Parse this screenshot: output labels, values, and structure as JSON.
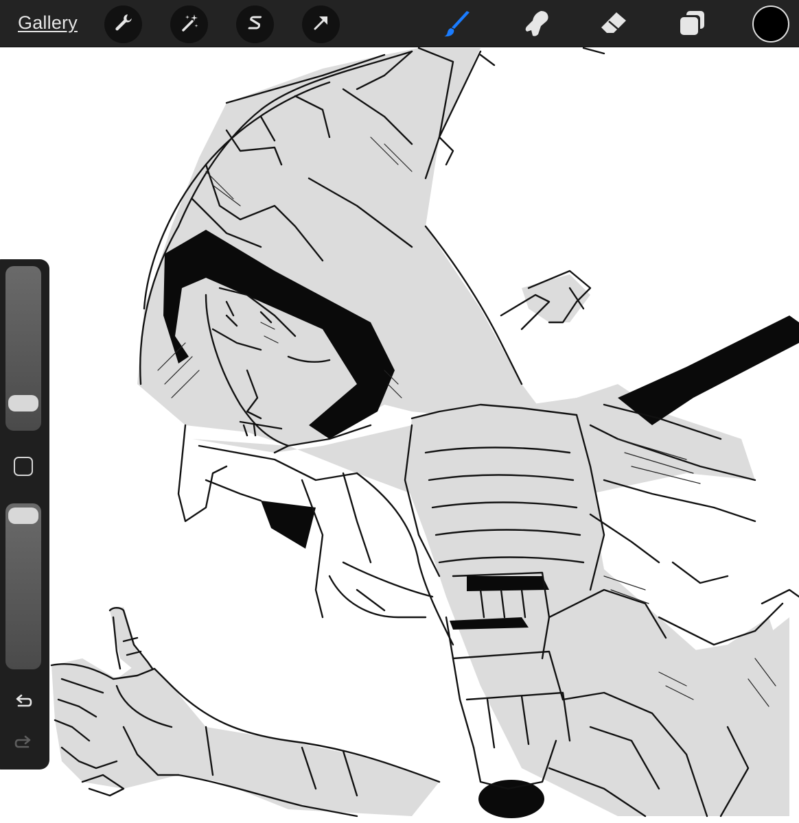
{
  "toolbar": {
    "gallery_label": "Gallery",
    "left_tools": [
      {
        "name": "actions-tool",
        "icon": "wrench-icon"
      },
      {
        "name": "adjustments-tool",
        "icon": "magic-wand-icon"
      },
      {
        "name": "selection-tool",
        "icon": "selection-s-icon"
      },
      {
        "name": "transform-tool",
        "icon": "arrow-cursor-icon"
      }
    ],
    "right_tools": [
      {
        "name": "brush-tool",
        "icon": "brush-icon",
        "active": true
      },
      {
        "name": "smudge-tool",
        "icon": "smudge-finger-icon",
        "active": false
      },
      {
        "name": "eraser-tool",
        "icon": "eraser-icon",
        "active": false
      },
      {
        "name": "layers-tool",
        "icon": "layers-icon",
        "active": false
      }
    ],
    "current_color": "#000000",
    "active_tool_color": "#1a7cff"
  },
  "sidebar": {
    "brush_size_level": 0.84,
    "brush_opacity_level": 1.0,
    "undo_icon": "undo-arrow-icon",
    "redo_icon": "redo-arrow-icon",
    "modify_icon": "square-modify-icon"
  },
  "canvas": {
    "content": "sketch-illustration"
  }
}
